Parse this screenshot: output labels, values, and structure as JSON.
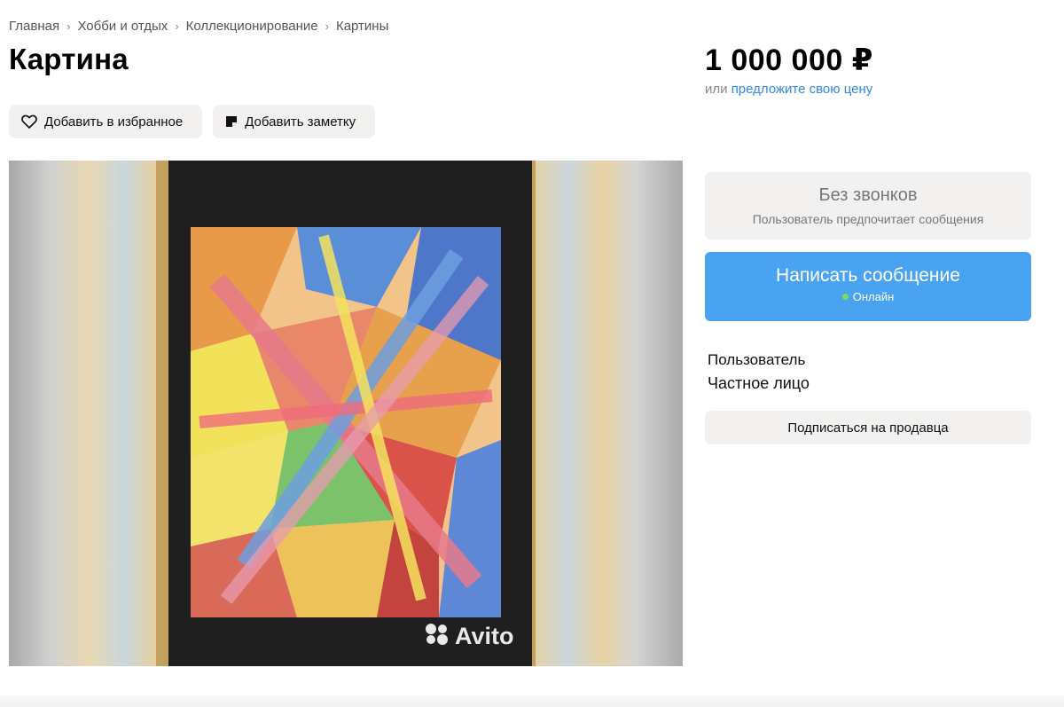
{
  "breadcrumb": [
    "Главная",
    "Хобби и отдых",
    "Коллекционирование",
    "Картины"
  ],
  "title": "Картина",
  "price": "1 000 000 ₽",
  "offer": {
    "prefix": "или",
    "link": "предложите свою цену"
  },
  "actions": {
    "favorite": "Добавить в избранное",
    "note": "Добавить заметку"
  },
  "contact": {
    "no_calls_title": "Без звонков",
    "no_calls_subtitle": "Пользователь предпочитает сообщения",
    "message_button": "Написать сообщение",
    "online_status": "Онлайн"
  },
  "seller": {
    "name": "Пользователь",
    "type": "Частное лицо",
    "subscribe": "Подписаться на продавца"
  },
  "gallery": {
    "watermark": "Avito"
  },
  "colors": {
    "accent_blue": "#4aa3f0",
    "link_blue": "#2f8be0",
    "online_green": "#7fdc52",
    "button_gray": "#f2f1f0"
  },
  "icons": {
    "favorite": "heart-icon",
    "note": "note-icon",
    "watermark": "avito-logo-icon"
  }
}
